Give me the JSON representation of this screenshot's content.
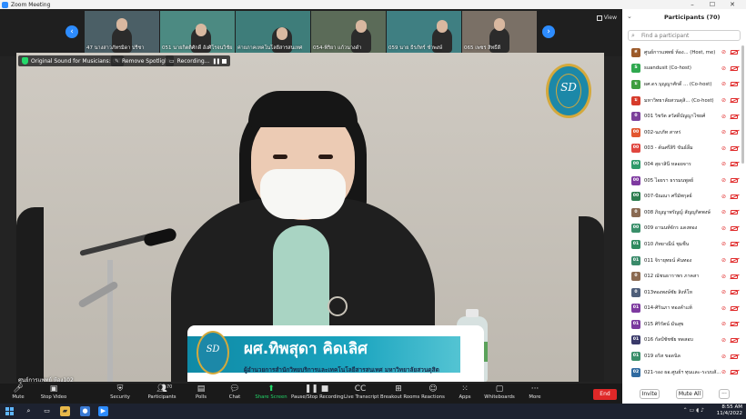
{
  "window": {
    "title": "Zoom Meeting",
    "controls": [
      "–",
      "☐",
      "✕"
    ]
  },
  "thumbnails": [
    {
      "name": "47 นางสาวภัทรมิดา ปรีชา",
      "bg": "#4b5f66"
    },
    {
      "name": "051 นายกิตติศักดิ์ อังศิโรจนวิชัย",
      "bg": "#4c8a82"
    },
    {
      "name": "ค่ายภาคเทคโนโลยีสารสนเทศ",
      "bg": "#3e7d7a"
    },
    {
      "name": "054-พิริยา แก้วนางดำ",
      "bg": "#5b6b58"
    },
    {
      "name": "059 นาย ธีรภัทร์ ชำพงษ์",
      "bg": "#3f7f82"
    },
    {
      "name": "065 เพชร สิทธิ์ดี",
      "bg": "#7a7066"
    }
  ],
  "view_label": "View",
  "top_controls": {
    "original_sound": "Original Sound for Musicians: Off",
    "remove_spotlight": "Remove Spotlight",
    "recording": "Recording..."
  },
  "banner": {
    "name": "ผศ.ทิพสุดา คิดเลิศ",
    "role": "ผู้อำนวยการสำนักวิทยบริการและเทคโนโลยีสารสนเทศ มหาวิทยาลัยสวนดุสิต"
  },
  "logo_mono": "SD",
  "speaker_name": "ศูนย์การแพทย์ ห้อง102",
  "toolbar": {
    "mute": "Mute",
    "stop_video": "Stop Video",
    "security": "Security",
    "participants": "Participants",
    "participants_count": "70",
    "polls": "Polls",
    "chat": "Chat",
    "share_screen": "Share Screen",
    "pause_recording": "Pause/Stop Recording",
    "live_transcript": "Live Transcript",
    "breakout_rooms": "Breakout Rooms",
    "reactions": "Reactions",
    "apps": "Apps",
    "whiteboards": "Whiteboards",
    "more": "More",
    "end": "End"
  },
  "panel": {
    "title": "Participants (70)",
    "search_placeholder": "Find a participant",
    "invite": "Invite",
    "mute_all": "Mute All",
    "more": "···"
  },
  "participants": [
    {
      "initials": "ศ",
      "name": "ศูนย์การแพทย์ ห้อง... (Host, me)",
      "color": "#9c5a2a"
    },
    {
      "initials": "S",
      "name": "suandusit (Co-host)",
      "color": "#2fa84f"
    },
    {
      "initials": "ม",
      "name": "ผศ.ดร.บุญญาศักดิ์ ... (Co-host)",
      "color": "#3e9e3e"
    },
    {
      "initials": "ม",
      "name": "มหาวิทยาลัยสวนดุสิ... (Co-host)",
      "color": "#d63b2b"
    },
    {
      "initials": "0",
      "name": "001 วิชรัต สวัสดิ์บัญญาไชยศ์",
      "color": "#7b3f9a"
    },
    {
      "initials": "00",
      "name": "002-นภภัท สาหร่",
      "color": "#e2562f"
    },
    {
      "initials": "00",
      "name": "003 - ต้นศรีสิริ ขันธ์ลิ้ม",
      "color": "#e0463f"
    },
    {
      "initials": "00",
      "name": "004 สุธาสินี หลอยจาร",
      "color": "#2f9a6a"
    },
    {
      "initials": "00",
      "name": "005 ไอยรา ธรรมนพูลย์",
      "color": "#7e3aa0"
    },
    {
      "initials": "00",
      "name": "007-ปัณณา ศรีมัทกุลย์",
      "color": "#2e7d4f"
    },
    {
      "initials": "0",
      "name": "008 ภิญญาพรัญญ์ สัญญกิตพงษ์",
      "color": "#8a6a52"
    },
    {
      "initials": "00",
      "name": "009 อานนท์จักร แดงทอง",
      "color": "#3a8f6a"
    },
    {
      "initials": "01",
      "name": "010 ภัทยาณีน์ ชุมชื่น",
      "color": "#2f8a5f"
    },
    {
      "initials": "01",
      "name": "011 จิรายุทธน์ คันทอง",
      "color": "#3a8a6a"
    },
    {
      "initials": "0",
      "name": "012 ณัชนธาราพร ภาคสา",
      "color": "#8b6a50"
    },
    {
      "initials": "0",
      "name": "013ทองพงษ์ชัย สิงห์โห",
      "color": "#4f5f7a"
    },
    {
      "initials": "01",
      "name": "014-ศิรินภา ทองคำแท้",
      "color": "#7e3aa0"
    },
    {
      "initials": "01",
      "name": "015 ศิริรัตน์ มั่นสุข",
      "color": "#7a3a9e"
    },
    {
      "initials": "01",
      "name": "016 กัลป์ชัชชัย ทดสอบ",
      "color": "#3a3a6a"
    },
    {
      "initials": "01",
      "name": "019 อริส ขอดนิล",
      "color": "#3a8f6a"
    },
    {
      "initials": "02",
      "name": "021-รอง ผอ.ศูนย์ฯ ทุนและ-ระบบสั...",
      "color": "#2f6aa0"
    }
  ],
  "taskbar": {
    "time": "8:55 AM",
    "date": "11/4/2022"
  },
  "colors": {
    "accent": "#2d8cff",
    "end_red": "#e02828",
    "share_green": "#23d96a",
    "muted_red": "#e02828"
  }
}
